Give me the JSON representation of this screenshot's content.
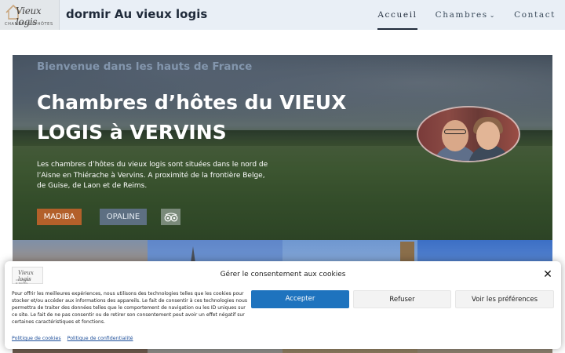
{
  "header": {
    "logo": {
      "script": "Vieux logis",
      "tagline": "CHAMBRES D'HÔTES"
    },
    "site_title": "dormir Au vieux logis",
    "nav": [
      {
        "label": "Accueil",
        "active": true
      },
      {
        "label": "Chambres",
        "has_dropdown": true
      },
      {
        "label": "Contact"
      }
    ]
  },
  "hero": {
    "eyebrow": "Bienvenue dans les hauts de France",
    "title": "Chambres d’hôtes du VIEUX LOGIS à VERVINS",
    "description": "Les chambres d’hôtes du vieux logis sont situées dans le nord de l’Aisne en Thiérache à Vervins. A proximité de la frontière Belge, de Guise, de Laon et de Reims.",
    "buttons": {
      "madiba": "MADIBA",
      "opaline": "OPALINE",
      "tripadvisor_icon": "tripadvisor-icon"
    },
    "colors": {
      "madiba": "#b3602a",
      "opaline": "#5d6f82"
    }
  },
  "cookie_banner": {
    "logo_script": "Vieux logis",
    "logo_tagline": "CHAMBRES D'HÔTES",
    "title": "Gérer le consentement aux cookies",
    "text": "Pour offrir les meilleures expériences, nous utilisons des technologies telles que les cookies pour stocker et/ou accéder aux informations des appareils. Le fait de consentir à ces technologies nous permettra de traiter des données telles que le comportement de navigation ou les ID uniques sur ce site. Le fait de ne pas consentir ou de retirer son consentement peut avoir un effet négatif sur certaines caractéristiques et fonctions.",
    "accept": "Accepter",
    "refuse": "Refuser",
    "preferences": "Voir les préférences",
    "links": {
      "cookie_policy": "Politique de cookies",
      "privacy_policy": "Politique de confidentialité"
    },
    "accent": "#1e73be"
  }
}
